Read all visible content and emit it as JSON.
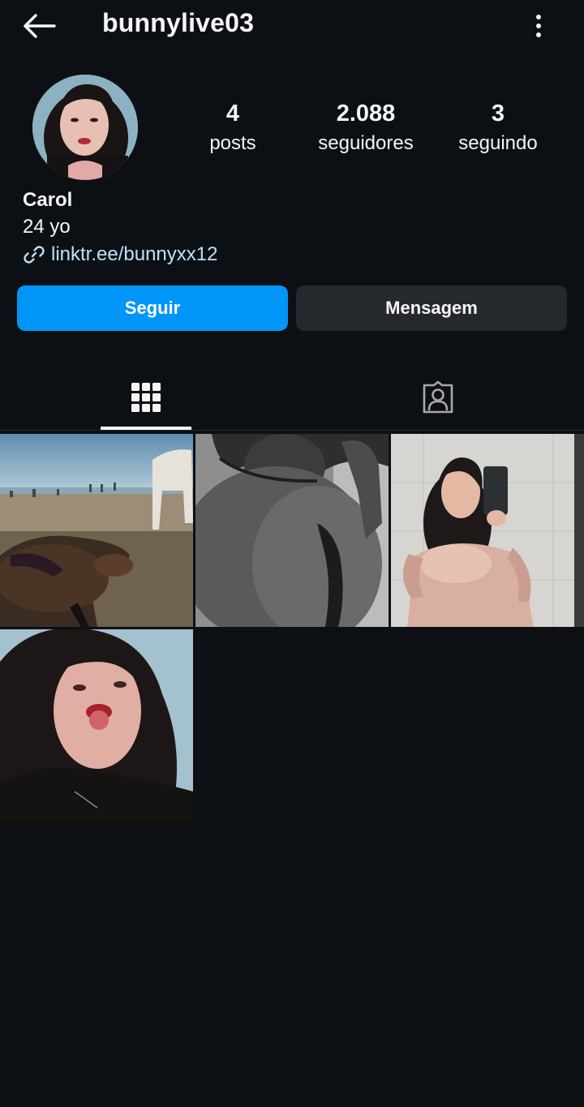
{
  "header": {
    "username": "bunnylive03",
    "back_icon": "arrow-left-icon",
    "more_icon": "more-vertical-icon"
  },
  "profile": {
    "stats": {
      "posts": {
        "value": "4",
        "label": "posts"
      },
      "followers": {
        "value": "2.088",
        "label": "seguidores"
      },
      "following": {
        "value": "3",
        "label": "seguindo"
      }
    },
    "display_name": "Carol",
    "bio": "24 yo",
    "link": "linktr.ee/bunnyxx12"
  },
  "actions": {
    "follow_label": "Seguir",
    "message_label": "Mensagem"
  },
  "tabs": [
    {
      "name": "posts-grid",
      "icon": "grid-icon",
      "active": true
    },
    {
      "name": "tagged",
      "icon": "tagged-user-icon",
      "active": false
    }
  ],
  "colors": {
    "background": "#0c1014",
    "accent": "#0095f6",
    "secondary_button": "#25292e",
    "link": "#bfe0f7",
    "text": "#f5f5f5"
  }
}
